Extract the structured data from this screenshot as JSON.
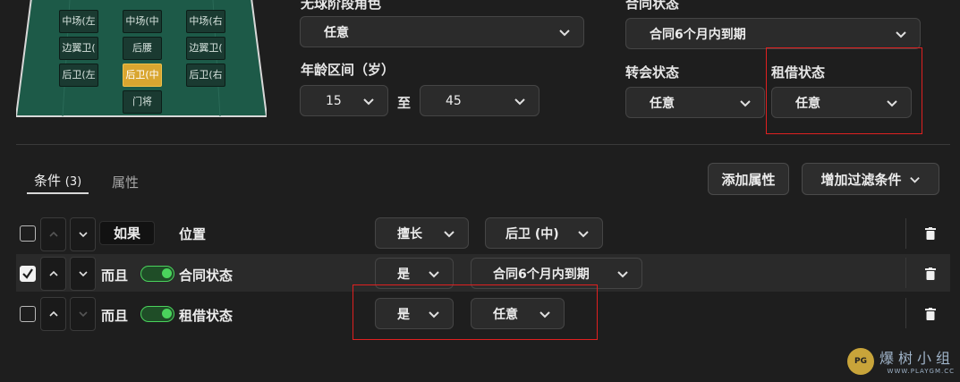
{
  "pitch": {
    "positions": [
      {
        "label": "中场(左",
        "selected": false
      },
      {
        "label": "中场(中",
        "selected": false
      },
      {
        "label": "中场(右",
        "selected": false
      },
      {
        "label": "边翼卫(",
        "selected": false
      },
      {
        "label": "后腰",
        "selected": false
      },
      {
        "label": "边翼卫(",
        "selected": false
      },
      {
        "label": "后卫(左",
        "selected": false
      },
      {
        "label": "后卫(中",
        "selected": true
      },
      {
        "label": "后卫(右",
        "selected": false
      },
      {
        "label": "门将",
        "selected": false
      }
    ]
  },
  "filters": {
    "no_ball_role": {
      "label": "无球阶段角色",
      "value": "任意"
    },
    "contract_status": {
      "label": "合同状态",
      "value": "合同6个月内到期"
    },
    "age_range": {
      "label": "年龄区间（岁）",
      "min": "15",
      "to": "至",
      "max": "45"
    },
    "transfer_status": {
      "label": "转会状态",
      "value": "任意"
    },
    "loan_status": {
      "label": "租借状态",
      "value": "任意"
    }
  },
  "tabs": {
    "conditions": {
      "label": "条件",
      "count": "(3)"
    },
    "attributes": {
      "label": "属性"
    }
  },
  "buttons": {
    "add_attribute": "添加属性",
    "add_filter": "增加过滤条件"
  },
  "rules": [
    {
      "checked": false,
      "logic": "如果",
      "field": "位置",
      "operator": "擅长",
      "value": "后卫 (中)",
      "has_toggle": false
    },
    {
      "checked": true,
      "logic": "而且",
      "field": "合同状态",
      "operator": "是",
      "value": "合同6个月内到期",
      "has_toggle": true
    },
    {
      "checked": false,
      "logic": "而且",
      "field": "租借状态",
      "operator": "是",
      "value": "任意",
      "has_toggle": true
    }
  ],
  "watermark": {
    "text": "爆树小组",
    "url": "WWW.PLAYGM.CC",
    "logo": "PG"
  },
  "colors": {
    "selected_position": "#d9a630",
    "toggle_on": "#4ad35c",
    "highlight": "#e02020",
    "pitch": "#1d5a48"
  }
}
